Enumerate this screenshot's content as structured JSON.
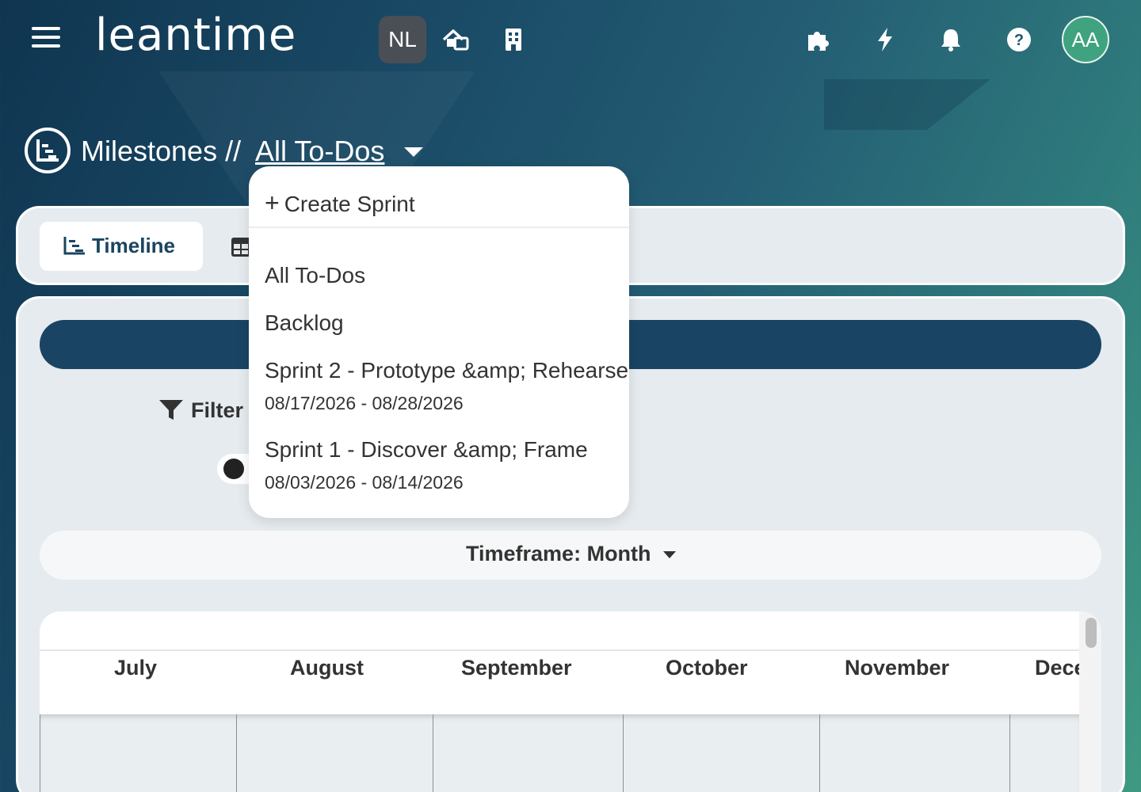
{
  "header": {
    "logo_text": "leantime",
    "project_badge": "NL",
    "avatar_initials": "AA"
  },
  "breadcrumb": {
    "section": "Milestones //",
    "current": "All To-Dos"
  },
  "tabs": {
    "timeline_label": "Timeline"
  },
  "filter": {
    "label": "Filter"
  },
  "timeframe": {
    "label": "Timeframe:",
    "value": "Month"
  },
  "gantt": {
    "months": [
      "July",
      "August",
      "September",
      "October",
      "November",
      "Dece"
    ]
  },
  "dropdown": {
    "create_label": "Create Sprint",
    "items": [
      {
        "label": "All To-Dos",
        "dates": ""
      },
      {
        "label": "Backlog",
        "dates": ""
      },
      {
        "label": "Sprint 2 - Prototype &amp; Rehearse",
        "dates": "08/17/2026 - 08/28/2026"
      },
      {
        "label": "Sprint 1 - Discover &amp; Frame",
        "dates": "08/03/2026 - 08/14/2026"
      }
    ]
  },
  "colors": {
    "primary": "#1a4464",
    "accent_green": "#3fa37f",
    "card_bg": "#e5ebee"
  },
  "icons": {
    "menu": "hamburger-icon",
    "home": "home-icon",
    "company": "building-icon",
    "apps": "puzzle-icon",
    "quick": "lightning-icon",
    "notifications": "bell-icon",
    "help": "help-icon"
  }
}
